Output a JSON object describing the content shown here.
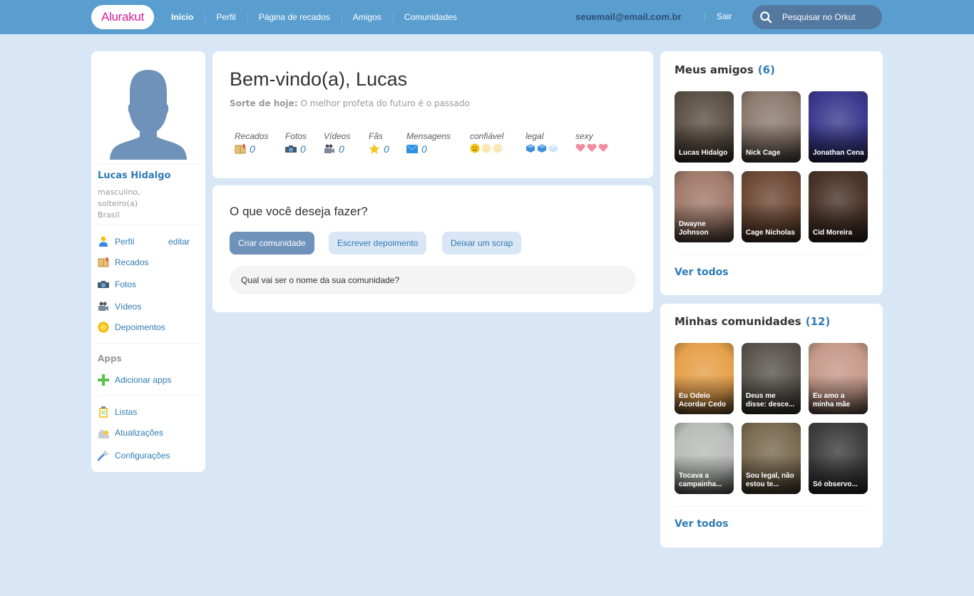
{
  "header": {
    "logo": "Alurakut",
    "nav": [
      {
        "label": "Início",
        "active": true
      },
      {
        "label": "Perfil",
        "active": false
      },
      {
        "label": "Página de recados",
        "active": false
      },
      {
        "label": "Amigos",
        "active": false
      },
      {
        "label": "Comunidades",
        "active": false
      }
    ],
    "email": "seuemail@email.com.br",
    "logout": "Sair",
    "search_placeholder": "Pesquisar no Orkut",
    "search_icon": "search-icon"
  },
  "profile": {
    "avatar_icon": "user-silhouette-icon",
    "name": "Lucas Hidalgo",
    "gender": "masculino,",
    "status": "solteiro(a)",
    "country": "Brasil",
    "edit_label": "editar",
    "menu": [
      {
        "label": "Perfil",
        "icon": "user-icon"
      },
      {
        "label": "Recados",
        "icon": "notebook-icon"
      },
      {
        "label": "Fotos",
        "icon": "camera-icon"
      },
      {
        "label": "Vídeos",
        "icon": "video-camera-icon"
      },
      {
        "label": "Depoimentos",
        "icon": "sun-icon"
      }
    ],
    "apps_title": "Apps",
    "apps": [
      {
        "label": "Adicionar apps",
        "icon": "plus-icon"
      }
    ],
    "more": [
      {
        "label": "Listas",
        "icon": "clipboard-icon"
      },
      {
        "label": "Atualizações",
        "icon": "updates-icon"
      },
      {
        "label": "Configurações",
        "icon": "wrench-icon"
      }
    ]
  },
  "welcome": {
    "title": "Bem-vindo(a), Lucas",
    "luck_label": "Sorte de hoje:",
    "luck_text": "O melhor profeta do futuro é o passado",
    "stats": [
      {
        "label": "Recados",
        "value": "0",
        "icon": "notebook-icon"
      },
      {
        "label": "Fotos",
        "value": "0",
        "icon": "camera-icon"
      },
      {
        "label": "Vídeos",
        "value": "0",
        "icon": "video-camera-icon"
      },
      {
        "label": "Fãs",
        "value": "0",
        "icon": "star-icon"
      },
      {
        "label": "Mensagens",
        "value": "0",
        "icon": "envelope-icon"
      }
    ],
    "ratings": [
      {
        "label": "confiável",
        "icon": "smiley-icon",
        "level": 1,
        "max": 3
      },
      {
        "label": "legal",
        "icon": "ice-cube-icon",
        "level": 2,
        "max": 3
      },
      {
        "label": "sexy",
        "icon": "heart-icon",
        "level": 3,
        "max": 3
      }
    ]
  },
  "actions": {
    "title": "O que você deseja fazer?",
    "buttons": [
      "Criar comunidade",
      "Escrever depoimento",
      "Deixar um scrap"
    ],
    "input_placeholder": "Qual vai ser o nome da sua comunidade?"
  },
  "friends": {
    "title": "Meus amigos",
    "count": "(6)",
    "items": [
      {
        "name": "Lucas Hidalgo",
        "color": "#5C5146"
      },
      {
        "name": "Nick Cage",
        "color": "#8C7A6E"
      },
      {
        "name": "Jonathan Cena",
        "color": "#3B3A8F"
      },
      {
        "name": "Dwayne Johnson",
        "color": "#A07A6A"
      },
      {
        "name": "Cage Nicholas",
        "color": "#6E4A36"
      },
      {
        "name": "Cid Moreira",
        "color": "#4A3428"
      }
    ],
    "see_all": "Ver todos"
  },
  "communities": {
    "title": "Minhas comunidades",
    "count": "(12)",
    "items": [
      {
        "name": "Eu Odeio Acordar Cedo",
        "color": "#E6A04A"
      },
      {
        "name": "Deus me disse: desce...",
        "color": "#5A554E"
      },
      {
        "name": "Eu amo a minha mãe",
        "color": "#C69A8A"
      },
      {
        "name": "Tocava a campainha...",
        "color": "#B9BDB8"
      },
      {
        "name": "Sou legal, não estou te...",
        "color": "#7A6A50"
      },
      {
        "name": "Só observo...",
        "color": "#3E3E3E"
      }
    ],
    "see_all": "Ver todos"
  }
}
